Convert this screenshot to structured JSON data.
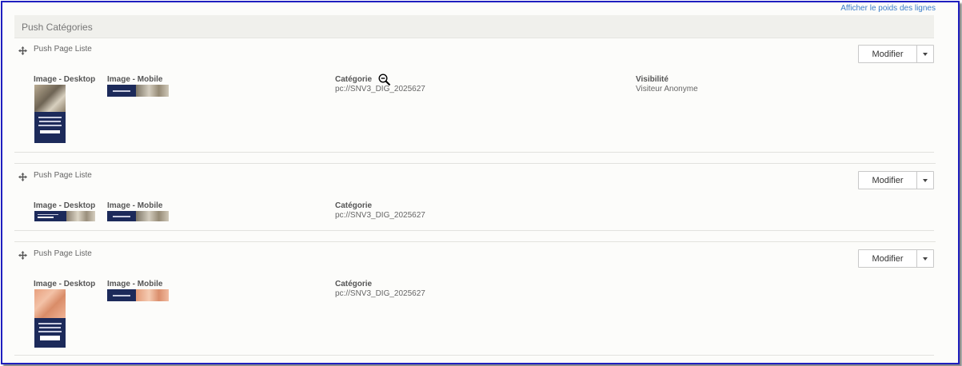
{
  "header": {
    "weights_link": "Afficher le poids des lignes",
    "panel_title": "Push Catégories"
  },
  "rows": [
    {
      "title": "Push Page Liste",
      "modify_label": "Modifier",
      "desktop_label": "Image - Desktop",
      "mobile_label": "Image - Mobile",
      "category_label": "Catégorie",
      "category_value": "pc://SNV3_DIG_2025627",
      "visibility_label": "Visibilité",
      "visibility_value": "Visiteur Anonyme"
    },
    {
      "title": "Push Page Liste",
      "modify_label": "Modifier",
      "desktop_label": "Image - Desktop",
      "mobile_label": "Image - Mobile",
      "category_label": "Catégorie",
      "category_value": "pc://SNV3_DIG_2025627"
    },
    {
      "title": "Push Page Liste",
      "modify_label": "Modifier",
      "desktop_label": "Image - Desktop",
      "mobile_label": "Image - Mobile",
      "category_label": "Catégorie",
      "category_value": "pc://SNV3_DIG_2025627"
    }
  ],
  "colors": {
    "frame_border": "#1f1fbf",
    "link": "#3a7dc9",
    "banner_navy": "#1c2a5a"
  },
  "icons": [
    "move-icon",
    "chevron-down-icon",
    "zoom-out-cursor-icon"
  ]
}
